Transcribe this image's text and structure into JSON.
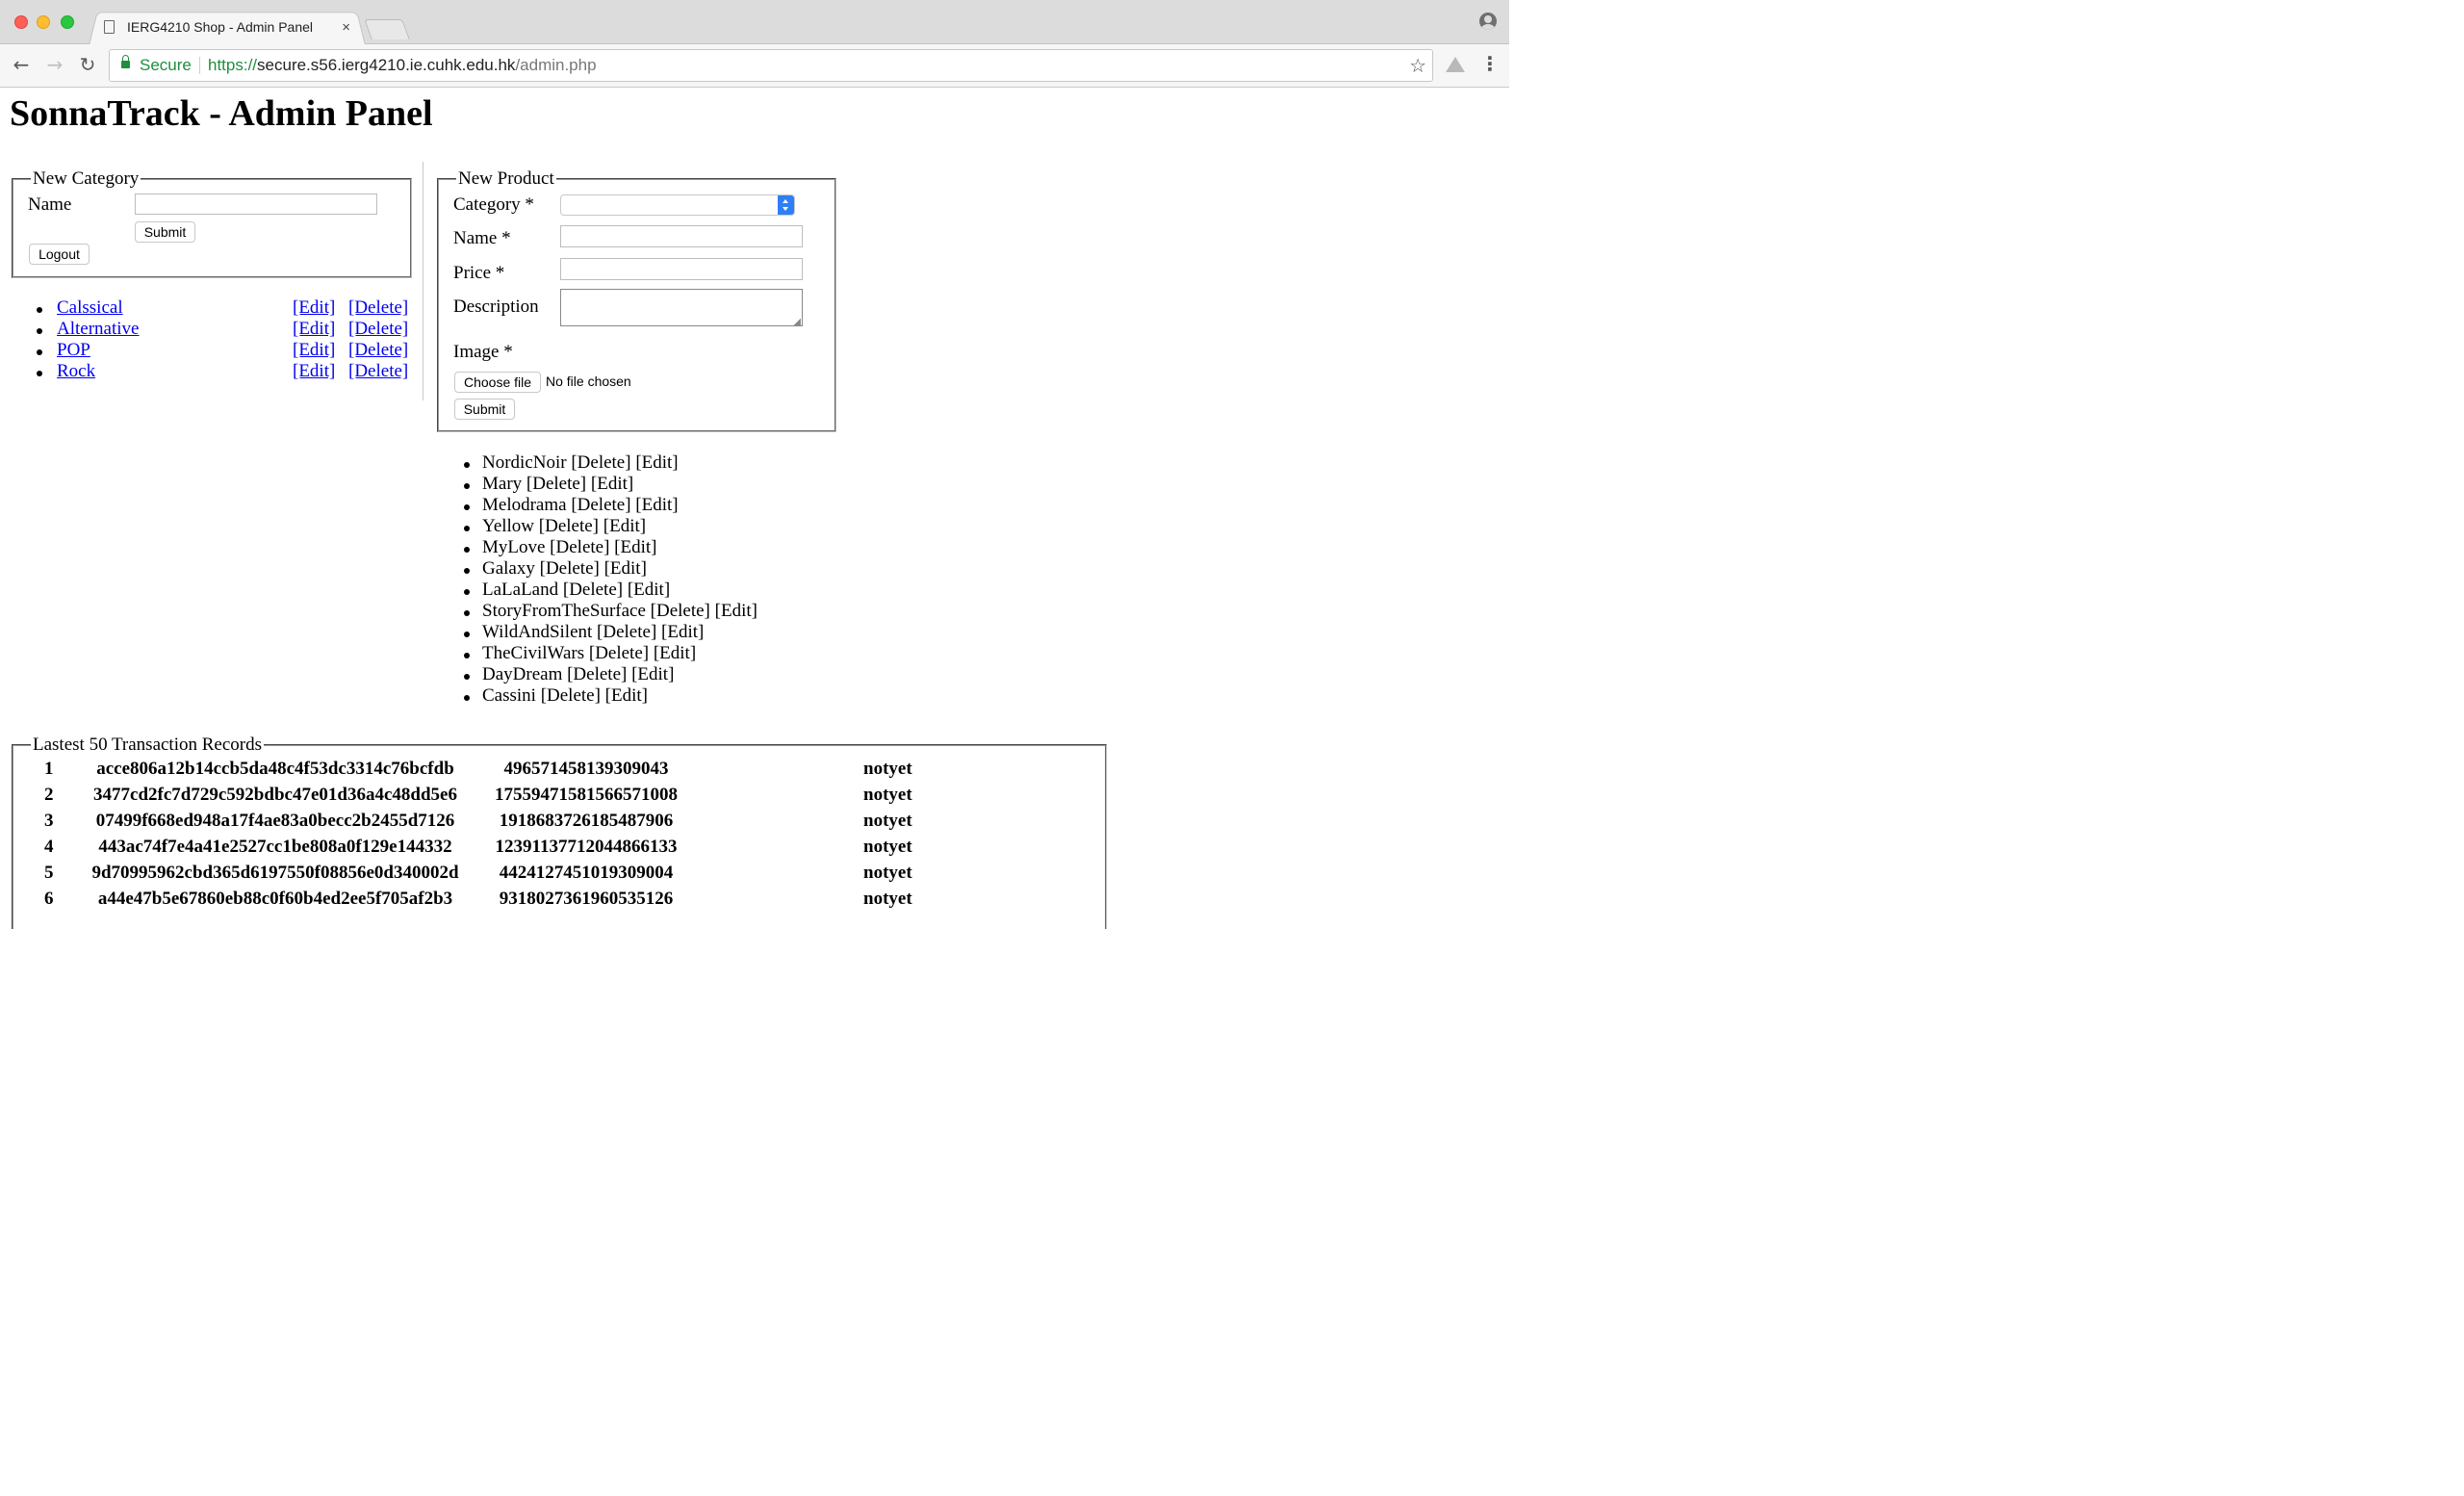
{
  "browser": {
    "tab_title": "IERG4210 Shop - Admin Panel",
    "tab_close": "×",
    "secure_label": "Secure",
    "url_scheme": "https://",
    "url_host": "secure.s56.ierg4210.ie.cuhk.edu.hk",
    "url_path": "/admin.php",
    "back_glyph": "←",
    "forward_glyph": "→",
    "reload_glyph": "↻",
    "star_glyph": "☆",
    "menu_glyph": "⋮"
  },
  "page": {
    "title": "SonnaTrack - Admin Panel"
  },
  "new_category": {
    "legend": "New Category",
    "name_label": "Name",
    "name_value": "",
    "submit_label": "Submit",
    "logout_label": "Logout"
  },
  "categories": [
    {
      "name": "Calssical",
      "edit": "[Edit]",
      "delete": "[Delete]"
    },
    {
      "name": "Alternative",
      "edit": "[Edit]",
      "delete": "[Delete]"
    },
    {
      "name": "POP",
      "edit": "[Edit]",
      "delete": "[Delete]"
    },
    {
      "name": "Rock",
      "edit": "[Edit]",
      "delete": "[Delete]"
    }
  ],
  "new_product": {
    "legend": "New Product",
    "category_label": "Category *",
    "category_value": "",
    "name_label": "Name *",
    "name_value": "",
    "price_label": "Price *",
    "price_value": "",
    "description_label": "Description",
    "description_value": "",
    "image_label": "Image *",
    "choose_file_label": "Choose file",
    "no_file_text": "No file chosen",
    "submit_label": "Submit"
  },
  "products": [
    {
      "text": "NordicNoir [Delete] [Edit]"
    },
    {
      "text": "Mary [Delete] [Edit]"
    },
    {
      "text": "Melodrama [Delete] [Edit]"
    },
    {
      "text": "Yellow [Delete] [Edit]"
    },
    {
      "text": "MyLove [Delete] [Edit]"
    },
    {
      "text": "Galaxy [Delete] [Edit]"
    },
    {
      "text": "LaLaLand [Delete] [Edit]"
    },
    {
      "text": "StoryFromTheSurface [Delete] [Edit]"
    },
    {
      "text": "WildAndSilent [Delete] [Edit]"
    },
    {
      "text": "TheCivilWars [Delete] [Edit]"
    },
    {
      "text": "DayDream [Delete] [Edit]"
    },
    {
      "text": "Cassini [Delete] [Edit]"
    }
  ],
  "transactions": {
    "legend": "Lastest 50 Transaction Records",
    "rows": [
      {
        "id": "1",
        "hash": "acce806a12b14ccb5da48c4f53dc3314c76bcfdb",
        "number": "496571458139309043",
        "status": "notyet"
      },
      {
        "id": "2",
        "hash": "3477cd2fc7d729c592bdbc47e01d36a4c48dd5e6",
        "number": "1755947158156657100​8",
        "status": "notyet"
      },
      {
        "id": "3",
        "hash": "07499f668ed948a17f4ae83a0becc2b2455d7126",
        "number": "1918683726185487906",
        "status": "notyet"
      },
      {
        "id": "4",
        "hash": "443ac74f7e4a41e2527cc1be808a0f129e144332",
        "number": "1239113771204486613​3",
        "status": "notyet"
      },
      {
        "id": "5",
        "hash": "9d70995962cbd365d6197550f08856e0d340002d",
        "number": "4424127451019309004",
        "status": "notyet"
      },
      {
        "id": "6",
        "hash": "a44e47b5e67860eb88c0f60b4ed2ee5f705af2b3",
        "number": "9318027361960535126",
        "status": "notyet"
      }
    ]
  }
}
